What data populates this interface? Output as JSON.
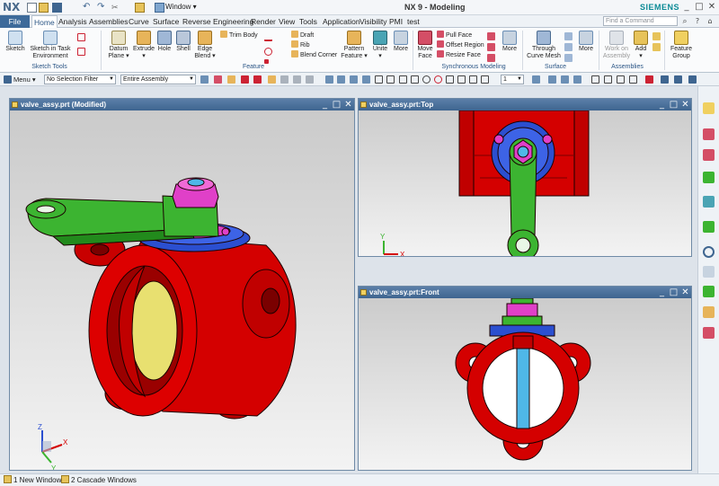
{
  "titlebar": {
    "logo": "NX",
    "window_menu": "Window",
    "app_title": "NX 9 - Modeling",
    "brand": "SIEMENS",
    "min": "_",
    "max": "□",
    "close": "✕"
  },
  "menu": {
    "file": "File",
    "tabs": [
      "Home",
      "Analysis",
      "Assemblies",
      "Curve",
      "Surface",
      "Reverse Engineering",
      "Render",
      "View",
      "Tools",
      "Application",
      "Visibility",
      "PMI",
      "test"
    ],
    "command_search_placeholder": "Find a Command"
  },
  "ribbon": {
    "sketch": "Sketch",
    "sketch_task_1": "Sketch in Task",
    "sketch_task_2": "Environment",
    "group_sketch_tools": "Sketch Tools",
    "datum_1": "Datum",
    "datum_2": "Plane ▾",
    "extrude_1": "Extrude",
    "extrude_2": "▾",
    "hole": "Hole",
    "shell": "Shell",
    "edge_blend_1": "Edge",
    "edge_blend_2": "Blend ▾",
    "trim_body": "Trim Body",
    "draft": "Draft",
    "rib": "Rib",
    "blend_corner": "Blend Corner",
    "pattern_1": "Pattern",
    "pattern_2": "Feature ▾",
    "unite_1": "Unite",
    "unite_2": "▾",
    "more": "More",
    "group_feature": "Feature",
    "move_face_1": "Move",
    "move_face_2": "Face",
    "pull_face": "Pull Face",
    "offset_region": "Offset Region",
    "resize_face": "Resize Face",
    "group_sync": "Synchronous Modeling",
    "through_1": "Through",
    "through_2": "Curve Mesh",
    "group_surface": "Surface",
    "work_on_1": "Work on",
    "work_on_2": "Assembly",
    "add_1": "Add",
    "add_2": "▾",
    "group_assemblies": "Assemblies",
    "feature_group_1": "Feature",
    "feature_group_2": "Group"
  },
  "toolbar2": {
    "menu": "Menu ▾",
    "selection_filter": "No Selection Filter",
    "scope": "Entire Assembly",
    "number": "1"
  },
  "viewports": {
    "iso": "valve_assy.prt (Modified)",
    "top": "valve_assy.prt:Top",
    "front": "valve_assy.prt:Front"
  },
  "axis": {
    "x": "X",
    "y": "Y",
    "z": "Z"
  },
  "status": {
    "new_window": "1 New Window",
    "cascade": "2 Cascade Windows"
  },
  "colors": {
    "body": "#d40000",
    "body_dark": "#7a0000",
    "handle": "#3cb431",
    "ring": "#2b4fd0",
    "nut": "#e040c8",
    "seal": "#e8e070",
    "stem": "#4fb7e8",
    "viewport_title": "#3e6590"
  }
}
